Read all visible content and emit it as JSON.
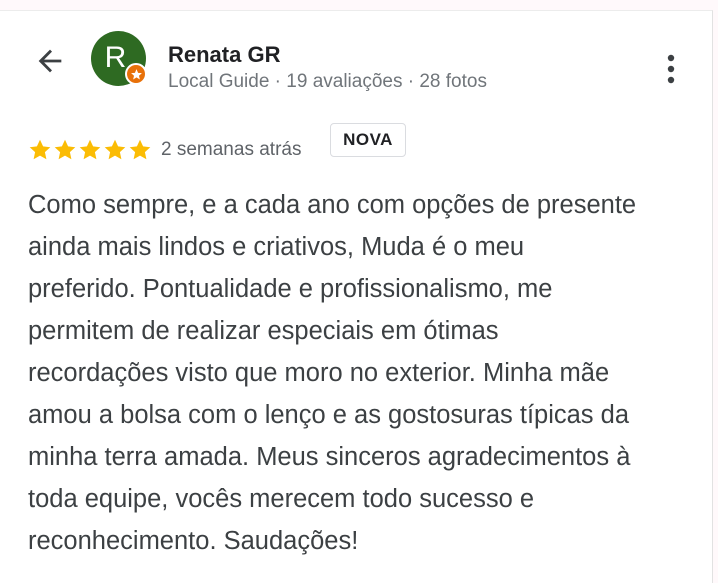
{
  "reviewer": {
    "name": "Renata GR",
    "avatar_initial": "R",
    "meta": "Local Guide · 19 avaliações · 28 fotos"
  },
  "icons": {
    "back": "arrow-back-icon",
    "more": "more-vert-icon",
    "star": "star-icon",
    "badge": "local-guide-star-icon"
  },
  "colors": {
    "avatar_bg": "#2e6a22",
    "star": "#fbbc04",
    "guide_badge": "#e8710a"
  },
  "review": {
    "rating": 5,
    "rating_max": 5,
    "date": "2 semanas atrás",
    "badge": "NOVA",
    "lines": [
      "Como sempre, e a cada ano com opções de presente",
      "ainda mais lindos e criativos, Muda é o meu",
      "preferido. Pontualidade e profissionalismo, me",
      "permitem de realizar especiais em ótimas",
      "recordações visto que moro no exterior. Minha mãe",
      "amou a bolsa com o lenço e as gostosuras típicas da",
      "minha terra amada. Meus sinceros agradecimentos à",
      "toda equipe, vocês merecem todo sucesso e",
      "reconhecimento. Saudações!"
    ]
  }
}
